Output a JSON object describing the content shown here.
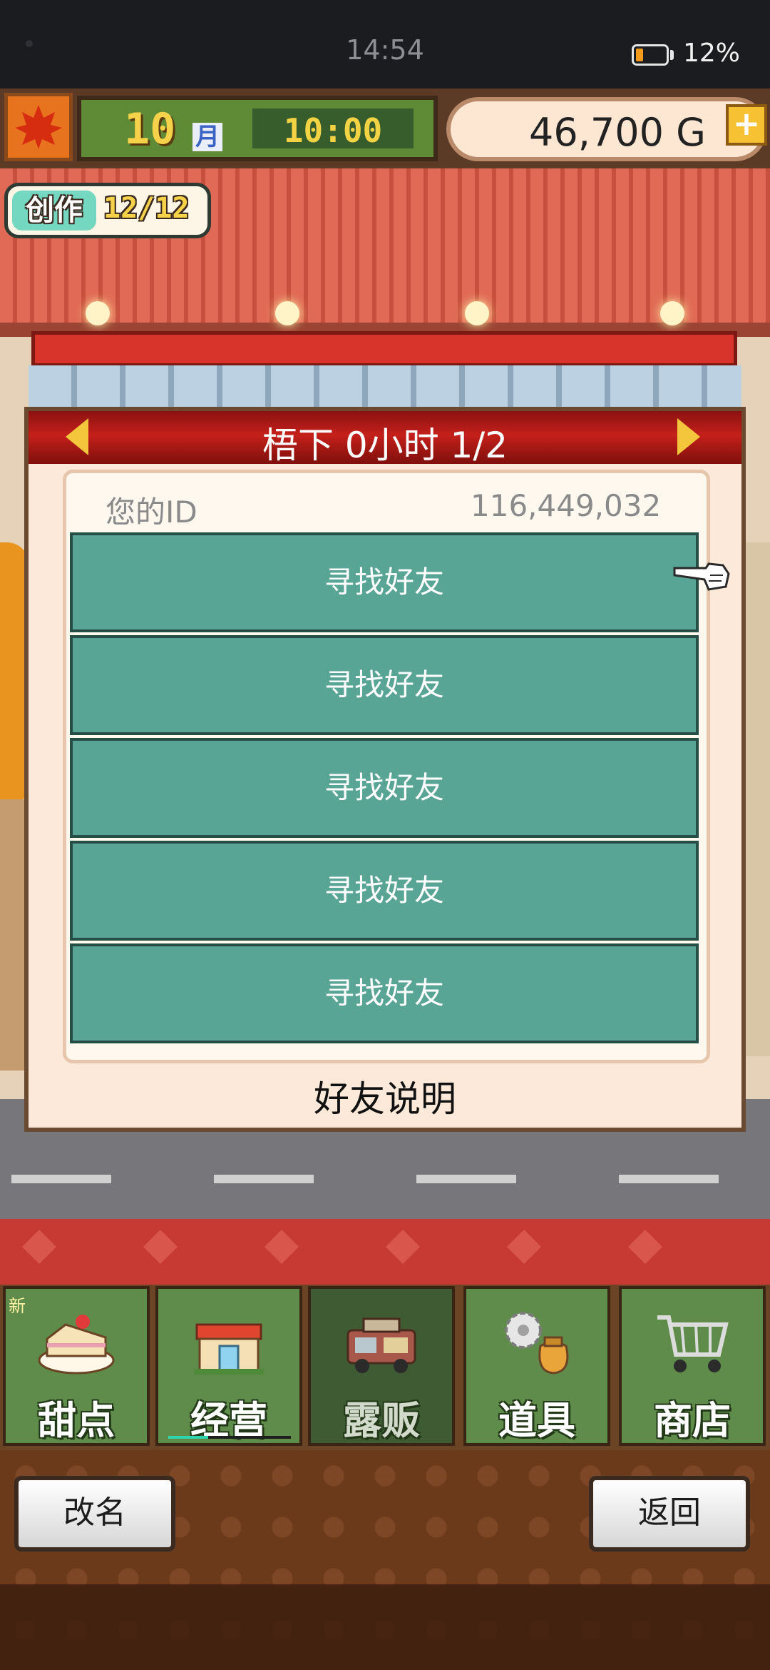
{
  "status_bar": {
    "time": "14:54",
    "battery_percent": "12%",
    "battery_level": 0.12
  },
  "header": {
    "month_number": "10",
    "month_unit": "月",
    "clock": "10:00",
    "money": "46,700 G",
    "money_plus": "+",
    "season_icon": "maple-leaf-icon"
  },
  "creation_badge": {
    "label": "创作",
    "count": "12/12"
  },
  "dialog": {
    "title": "梧下 0小时 1/2",
    "id_label": "您的ID",
    "id_value": "116,449,032",
    "slots": [
      "寻找好友",
      "寻找好友",
      "寻找好友",
      "寻找好友",
      "寻找好友"
    ],
    "help_label": "好友说明"
  },
  "nav": {
    "items": [
      {
        "label": "甜点",
        "icon": "cake-icon",
        "badge": "新"
      },
      {
        "label": "经营",
        "icon": "shop-icon"
      },
      {
        "label": "露贩",
        "icon": "food-truck-icon",
        "active": true
      },
      {
        "label": "道具",
        "icon": "gear-bag-icon"
      },
      {
        "label": "商店",
        "icon": "cart-icon"
      }
    ]
  },
  "footer": {
    "rename_label": "改名",
    "back_label": "返回"
  },
  "colors": {
    "slot_teal": "#58a595",
    "title_red": "#c5201b",
    "nav_green": "#5f8c4a"
  }
}
